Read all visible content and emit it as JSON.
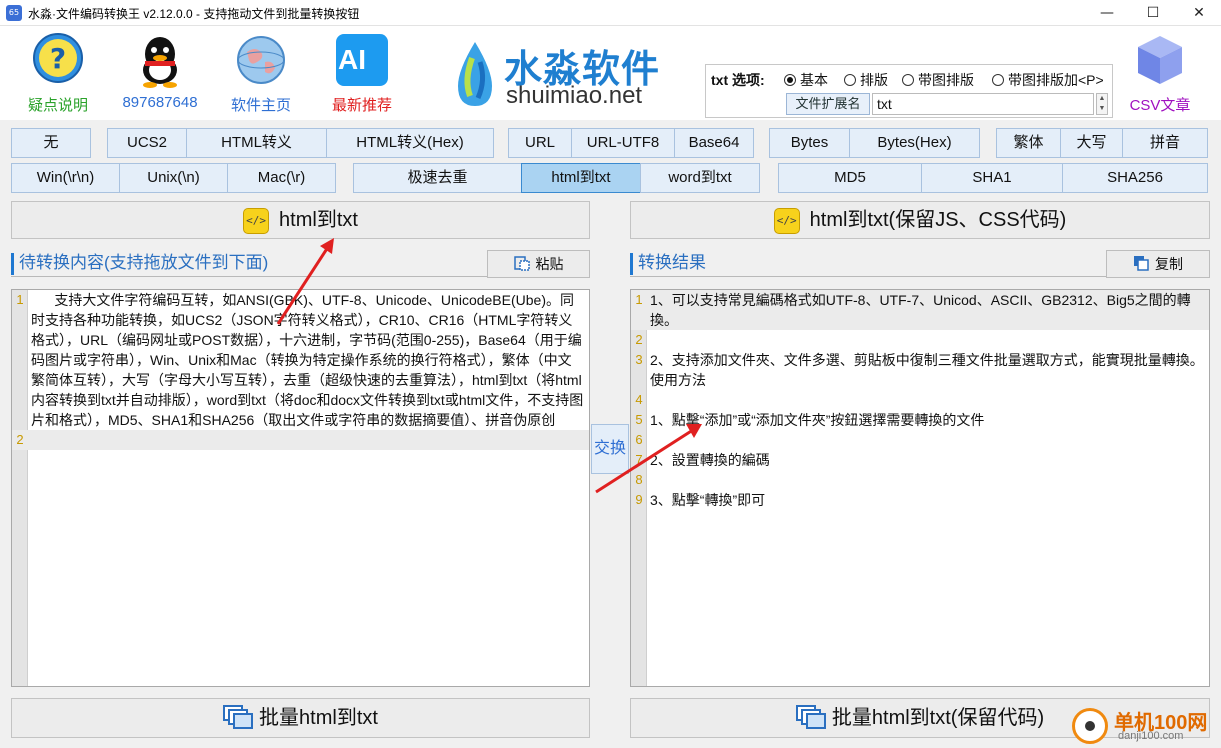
{
  "window": {
    "title": "水淼·文件编码转换王 v2.12.0.0 - 支持拖动文件到批量转换按钮",
    "app_icon_text": "65",
    "minimize": "—",
    "maximize": "☐",
    "close": "✕"
  },
  "toolbar": {
    "help_label": "疑点说明",
    "qq_label": "897687648",
    "home_label": "软件主页",
    "ai_label": "最新推荐",
    "ai_icon_text": "AI",
    "csv_label": "CSV文章"
  },
  "brand": {
    "name_cn": "水淼软件",
    "name_en": "shuimiao.net"
  },
  "txt_options": {
    "label": "txt 选项:",
    "options": [
      "基本",
      "排版",
      "带图排版",
      "带图排版加<P>"
    ],
    "selected_index": 0,
    "ext_label": "文件扩展名",
    "ext_value": "txt"
  },
  "row1": [
    "无",
    "UCS2",
    "HTML转义",
    "HTML转义(Hex)",
    "URL",
    "URL-UTF8",
    "Base64",
    "Bytes",
    "Bytes(Hex)",
    "繁体",
    "大写",
    "拼音"
  ],
  "row2": [
    "Win(\\r\\n)",
    "Unix(\\n)",
    "Mac(\\r)",
    "极速去重",
    "html到txt",
    "word到txt",
    "MD5",
    "SHA1",
    "SHA256"
  ],
  "row2_active": "html到txt",
  "left": {
    "convert_button": "html到txt",
    "panel_title": "待转换内容(支持拖放文件到下面)",
    "paste_button": "粘贴",
    "lines": [
      {
        "num": "1",
        "text": "      支持大文件字符编码互转，如ANSI(GBK)、UTF-8、Unicode、UnicodeBE(Ube)。同时支持各种功能转换，如UCS2（JSON字符转义格式），CR10、CR16（HTML字符转义格式），URL（编码网址或POST数据），十六进制，字节码(范围0-255)，Base64（用于编码图片或字符串），Win、Unix和Mac（转换为特定操作系统的换行符格式），繁体（中文繁简体互转），大写（字母大小写互转），去重（超级快速的去重算法），html到txt（将html内容转换到txt并自动排版），word到txt（将doc和docx文件转换到txt或html文件，不支持图片和格式），MD5、SHA1和SHA256（取出文件或字符串的数据摘要值）、拼音伪原创"
      },
      {
        "num": "2",
        "text": ""
      }
    ],
    "batch_button": "批量html到txt"
  },
  "swap_button": "交换",
  "right": {
    "convert_button": "html到txt(保留JS、CSS代码)",
    "panel_title": "转换结果",
    "copy_button": "复制",
    "lines": [
      {
        "num": "1",
        "text": "1、可以支持常見編碼格式如UTF-8、UTF-7、Unicod、ASCII、GB2312、Big5之間的轉換。"
      },
      {
        "num": "2",
        "text": ""
      },
      {
        "num": "3",
        "text": "2、支持添加文件夾、文件多選、剪貼板中復制三種文件批量選取方式，能實現批量轉換。 使用方法"
      },
      {
        "num": "4",
        "text": ""
      },
      {
        "num": "5",
        "text": "1、點擊“添加”或“添加文件夾”按鈕選擇需要轉換的文件"
      },
      {
        "num": "6",
        "text": ""
      },
      {
        "num": "7",
        "text": "2、設置轉換的編碼"
      },
      {
        "num": "8",
        "text": ""
      },
      {
        "num": "9",
        "text": "3、點擊“轉換”即可"
      }
    ],
    "batch_button": "批量html到txt(保留代码)"
  },
  "watermark": {
    "cn": "单机100网",
    "en": "danji100.com"
  },
  "colors": {
    "button_bg": "#e4eef9",
    "button_border": "#a9c2df",
    "active_bg": "#aad3f2",
    "panel_title": "#2a6fc0",
    "line_number": "#c89a00",
    "arrow": "#e02020"
  }
}
